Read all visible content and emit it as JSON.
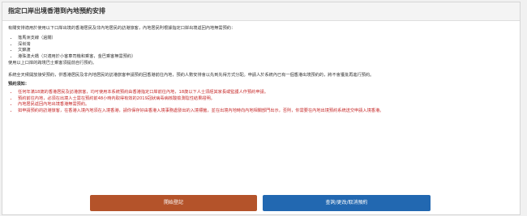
{
  "panel": {
    "title": "指定口岸出境香港到內地預約安排"
  },
  "intro": "有關安排適用於使用以下口岸出境的香港居民及非內地居民的訪港旅客，內地居民則根據指定口岸出境返回內地無需預約：",
  "crossings": [
    "落馬洲支線（過關）",
    "深圳灣",
    "文錦渡",
    "港珠澳大橋（只適用於小客車司機和乘客，金巴乘客無需預約）"
  ],
  "crossings_note": "使用以上口岸的跨境巴士乘客須提前自行預約。",
  "rule_text": "系統全天候開放接受預約，供香港居民及非內地居民的訪港旅客申請預約回香港前往內地，預約人數安排會以先到先得方式分配。申請人於系統內已有一個香港出境預約的，將不會獲批再進行預約。",
  "notice_title": "預約須知：",
  "notes": [
    "任何年滿18歲的香港居民及訪港旅客，均可使用本系統預約由香港指定口岸前往內地，18歲以下人士須經其家長或監護人作預約申請。",
    "預約前往內地，必須在出境人士需在預約前48小時內取得有效的2019冠狀病毒病核酸檢測陰性結果證明。",
    "內地居民返回內地出境香港無需預約。",
    "如申請預約的訪港旅客，在香港入境內地須在入境香港，請你保存好由香港入境事務處發出的入境標籤，並在出境內地時向內地相關部門出示，否則，你需要在內地出境預約系統送交申請入境香港。"
  ],
  "buttons": {
    "start": "開始登記",
    "query": "查詢/更改/取消預約"
  },
  "colors": {
    "note_red": "#c62828",
    "start_button": "#b4532a",
    "query_button": "#2268b1"
  }
}
